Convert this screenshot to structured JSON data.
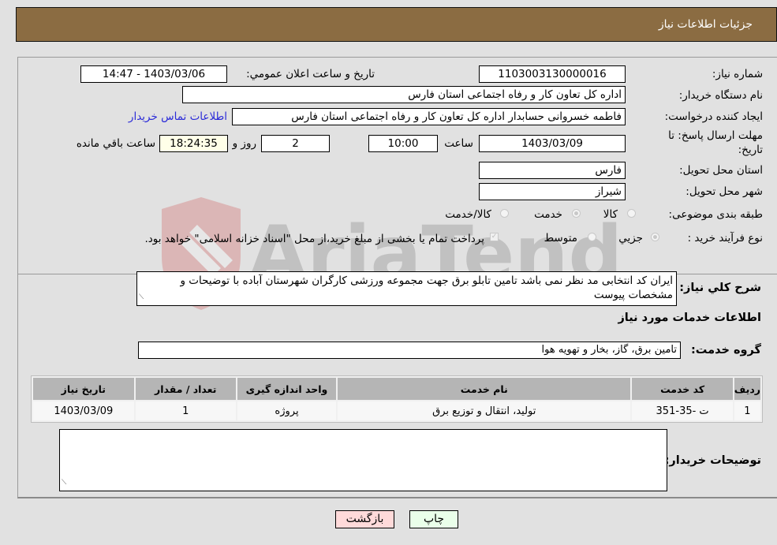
{
  "header": {
    "title": "جزئيات اطلاعات نياز"
  },
  "fields": {
    "need_number": {
      "label": "شماره نياز:",
      "value": "1103003130000016"
    },
    "announce_datetime": {
      "label": "تاريخ و ساعت اعلان عمومي:",
      "value": "1403/03/06 - 14:47"
    },
    "buyer_org": {
      "label": "نام دستگاه خريدار:",
      "value": "اداره کل تعاون  کار و رفاه اجتماعی استان فارس"
    },
    "requester": {
      "label": "ايجاد کننده درخواست:",
      "value": "فاطمه خسروانی حسابدار اداره کل تعاون  کار و رفاه اجتماعی استان فارس"
    },
    "buyer_contact_link": "اطلاعات تماس خريدار",
    "deadline": {
      "label_line1": "مهلت ارسال پاسخ: تا",
      "label_line2": "تاريخ:",
      "date": "1403/03/09",
      "time_label": "ساعت",
      "time": "10:00",
      "days": "2",
      "days_label": "روز و",
      "remaining": "18:24:35",
      "remaining_label": "ساعت باقي مانده"
    },
    "delivery_province": {
      "label": "استان محل تحويل:",
      "value": "فارس"
    },
    "delivery_city": {
      "label": "شهر محل تحويل:",
      "value": "شيراز"
    },
    "category": {
      "label": "طبقه بندی موضوعی:",
      "options": [
        "کالا",
        "خدمت",
        "کالا/خدمت"
      ],
      "selected": "خدمت"
    },
    "purchase_type": {
      "label": "نوع فرآيند خريد :",
      "options": [
        "جزيي",
        "متوسط"
      ],
      "selected": "جزيي",
      "treasury_note": "پرداخت تمام يا بخشی از مبلغ خريد،از محل \"اسناد خزانه اسلامی\" خواهد بود.",
      "treasury_checked": true
    }
  },
  "description": {
    "label": "شرح كلي نياز:",
    "value": "ايران کد انتخابی مد نظر نمی باشد تامين تابلو برق جهت مجموعه ورزشی کارگران شهرستان آباده با توضيحات و مشخصات پيوست"
  },
  "services_section": {
    "title": "اطلاعات خدمات مورد نياز",
    "group_label": "گروه خدمت:",
    "group_value": "تامين برق، گاز، بخار و تهويه هوا"
  },
  "table": {
    "headers": [
      "رديف",
      "کد خدمت",
      "نام خدمت",
      "واحد اندازه گيری",
      "تعداد / مقدار",
      "تاريخ نياز"
    ],
    "rows": [
      [
        "1",
        "ت -35-351",
        "توليد، انتقال و توزيع برق",
        "پروژه",
        "1",
        "1403/03/09"
      ]
    ]
  },
  "buyer_notes": {
    "label": "توضيحات خريدار:",
    "value": ""
  },
  "buttons": {
    "print": "چاپ",
    "back": "بازگشت"
  },
  "watermark": "AriaTender.neT",
  "colors": {
    "header_bg": "#8b6c42",
    "print_bg": "#eaffea",
    "back_bg": "#ffdada",
    "link": "#2b2bd8"
  }
}
